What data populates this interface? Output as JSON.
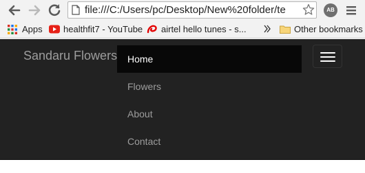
{
  "browser": {
    "url": "file:///C:/Users/pc/Desktop/New%20folder/te",
    "extension_badge": "AB",
    "icons": {
      "back": "arrow-left-icon",
      "forward": "arrow-right-icon",
      "reload": "reload-icon",
      "page": "file-icon",
      "star": "star-icon",
      "menu": "hamburger-icon"
    }
  },
  "bookmarks": {
    "apps_label": "Apps",
    "youtube_label": "healthfit7 - YouTube",
    "airtel_label": "airtel hello tunes - s...",
    "other_label": "Other bookmarks"
  },
  "navbar": {
    "brand": "Sandaru Flowers",
    "items": [
      {
        "label": "Home",
        "active": true
      },
      {
        "label": "Flowers",
        "active": false
      },
      {
        "label": "About",
        "active": false
      },
      {
        "label": "Contact",
        "active": false
      }
    ]
  },
  "colors": {
    "navbar_bg": "#222222",
    "active_item_bg": "#080808",
    "link_color": "#9d9d9d",
    "active_link_color": "#ffffff"
  }
}
